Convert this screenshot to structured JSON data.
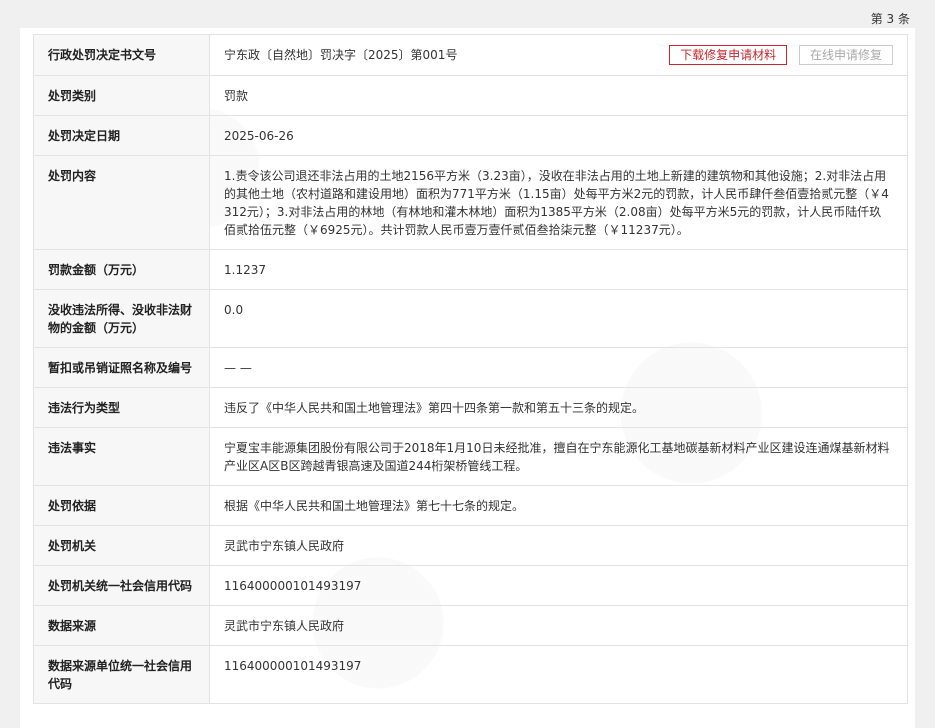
{
  "page_count": "第 3 条",
  "actions": {
    "download_label": "下载修复申请材料",
    "online_label": "在线申请修复"
  },
  "colors": {
    "accent": "#c7272d",
    "label_bg": "#f7f7f7",
    "border": "#e3e3e3"
  },
  "rows": [
    {
      "label": "行政处罚决定书文号",
      "value": "宁东政〔自然地〕罚决字〔2025〕第001号"
    },
    {
      "label": "处罚类别",
      "value": "罚款"
    },
    {
      "label": "处罚决定日期",
      "value": "2025-06-26"
    },
    {
      "label": "处罚内容",
      "value": "1.责令该公司退还非法占用的土地2156平方米（3.23亩），没收在非法占用的土地上新建的建筑物和其他设施；2.对非法占用的其他土地（农村道路和建设用地）面积为771平方米（1.15亩）处每平方米2元的罚款，计人民币肆仟叁佰壹拾贰元整（￥4312元）；3.对非法占用的林地（有林地和灌木林地）面积为1385平方米（2.08亩）处每平方米5元的罚款，计人民币陆仟玖佰贰拾伍元整（￥6925元）。共计罚款人民币壹万壹仟贰佰叁拾柒元整（￥11237元）。"
    },
    {
      "label": "罚款金额（万元）",
      "value": "1.1237"
    },
    {
      "label": "没收违法所得、没收非法财物的金额（万元）",
      "value": "0.0"
    },
    {
      "label": "暂扣或吊销证照名称及编号",
      "value": "— —"
    },
    {
      "label": "违法行为类型",
      "value": "违反了《中华人民共和国土地管理法》第四十四条第一款和第五十三条的规定。"
    },
    {
      "label": "违法事实",
      "value": "宁夏宝丰能源集团股份有限公司于2018年1月10日未经批准，擅自在宁东能源化工基地碳基新材料产业区建设连通煤基新材料产业区A区B区跨越青银高速及国道244桁架桥管线工程。"
    },
    {
      "label": "处罚依据",
      "value": "根据《中华人民共和国土地管理法》第七十七条的规定。"
    },
    {
      "label": "处罚机关",
      "value": "灵武市宁东镇人民政府"
    },
    {
      "label": "处罚机关统一社会信用代码",
      "value": "11640000010149319​7"
    },
    {
      "label": "数据来源",
      "value": "灵武市宁东镇人民政府"
    },
    {
      "label": "数据来源单位统一社会信用代码",
      "value": "116400000101493197"
    }
  ]
}
